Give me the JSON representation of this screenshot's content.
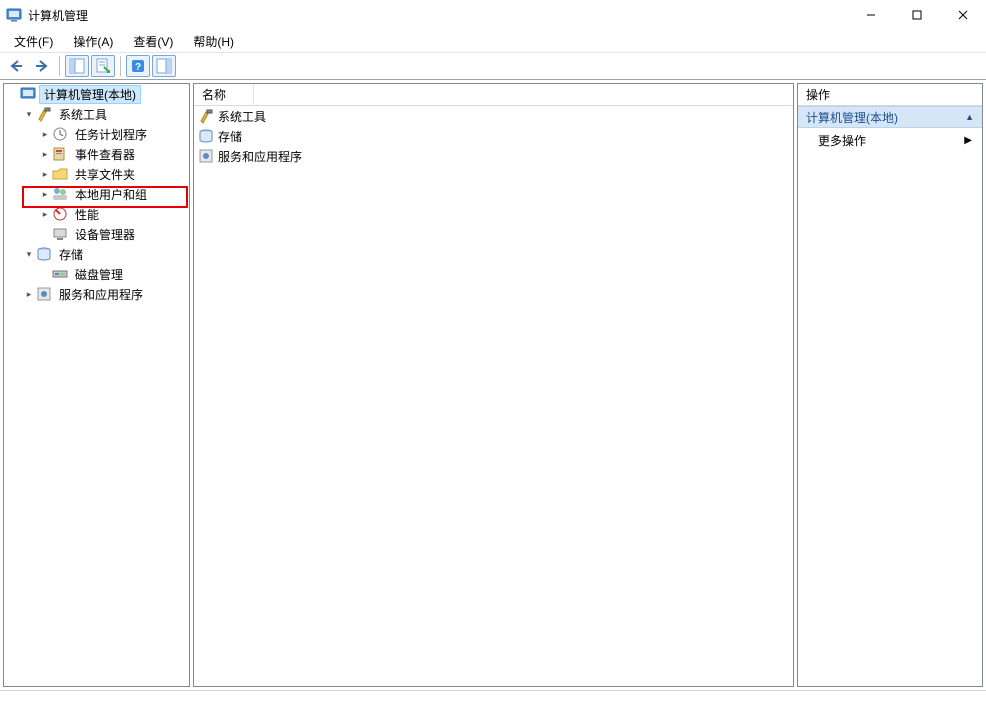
{
  "title": "计算机管理",
  "menu": {
    "file": "文件(F)",
    "action": "操作(A)",
    "view": "查看(V)",
    "help": "帮助(H)"
  },
  "tree": {
    "root": "计算机管理(本地)",
    "system_tools": "系统工具",
    "task_scheduler": "任务计划程序",
    "event_viewer": "事件查看器",
    "shared_folders": "共享文件夹",
    "local_users_groups": "本地用户和组",
    "performance": "性能",
    "device_manager": "设备管理器",
    "storage": "存储",
    "disk_management": "磁盘管理",
    "services_apps": "服务和应用程序"
  },
  "list": {
    "col_name": "名称",
    "items": {
      "system_tools": "系统工具",
      "storage": "存储",
      "services_apps": "服务和应用程序"
    }
  },
  "actions": {
    "header": "操作",
    "group": "计算机管理(本地)",
    "more": "更多操作"
  }
}
